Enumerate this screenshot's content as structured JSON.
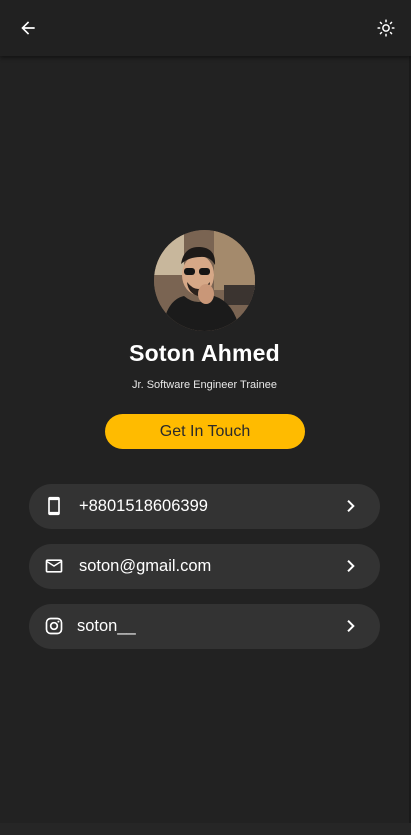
{
  "profile": {
    "name": "Soton Ahmed",
    "role": "Jr. Software Engineer Trainee",
    "avatar_icon": "profile-photo"
  },
  "actions": {
    "get_in_touch_label": "Get In Touch"
  },
  "contacts": [
    {
      "icon": "smartphone-icon",
      "value": "+8801518606399"
    },
    {
      "icon": "mail-icon",
      "value": "soton@gmail.com"
    },
    {
      "icon": "instagram-icon",
      "value": "soton__"
    }
  ],
  "colors": {
    "background": "#222222",
    "app_bar": "#212121",
    "accent": "#ffbb00",
    "card": "#333333",
    "text": "#ffffff"
  },
  "app_bar": {
    "back_icon": "arrow-left-icon",
    "theme_icon": "sun-icon"
  }
}
